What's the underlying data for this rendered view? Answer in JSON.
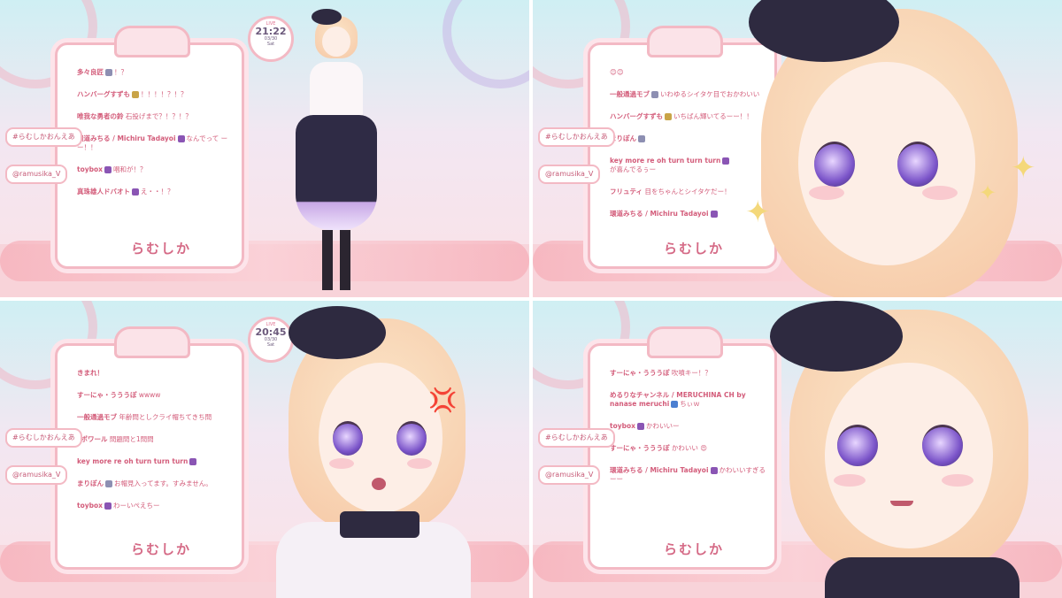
{
  "panels": [
    {
      "chat_tag": "#らむしかおんえあ",
      "handle_tag": "@ramusika_V",
      "logo": "らむしか",
      "clock": {
        "live": "LIVE",
        "time": "21:22",
        "date": "03/30",
        "day": "Sat"
      },
      "messages": [
        {
          "name": "多々良匠",
          "text": "！？"
        },
        {
          "name": "ハンバーグすずも",
          "text": "！！！！？！？"
        },
        {
          "name": "唯我な勇者の鈴",
          "text": "石投げまで？！？！？"
        },
        {
          "name": "環道みちる / Michiru Tadayoi",
          "text": "なんでって ーー！！"
        },
        {
          "name": "toybox",
          "text": "唱和が！？"
        },
        {
          "name": "真珠雄人ドバオト",
          "text": "え・・！？"
        }
      ]
    },
    {
      "chat_tag": "#らむしかおんえあ",
      "handle_tag": "@ramusika_V",
      "logo": "らむしか",
      "messages": [
        {
          "name": "",
          "text": "😊😊"
        },
        {
          "name": "一般通過モブ",
          "text": "いわゆるシイタケ目でおかわいい"
        },
        {
          "name": "ハンバーグすずも",
          "text": "いちばん輝いてるーー！！"
        },
        {
          "name": "まりぽん",
          "text": ""
        },
        {
          "name": "key more re oh turn turn turn",
          "text": "が喜んでるぅー"
        },
        {
          "name": "フリュティ",
          "text": "目をちゃんとシイタケだー！"
        },
        {
          "name": "環道みちる / Michiru Tadayoi",
          "text": ""
        }
      ]
    },
    {
      "chat_tag": "#らむしかおんえあ",
      "handle_tag": "@ramusika_V",
      "logo": "らむしか",
      "clock": {
        "live": "LIVE",
        "time": "20:45",
        "date": "03/30",
        "day": "Sat"
      },
      "messages": [
        {
          "name": "きまれ！",
          "text": ""
        },
        {
          "name": "すーにゃ・うううぽ",
          "text": "wwww"
        },
        {
          "name": "一般通過モブ",
          "text": "年齢問としクライ帽ちてきち問"
        },
        {
          "name": "sポワール",
          "text": "問題問と1問問"
        },
        {
          "name": "key more re oh turn turn turn",
          "text": ""
        },
        {
          "name": "まりぽん",
          "text": "お帽見入ってます。すみません。"
        },
        {
          "name": "toybox",
          "text": "わーいぺえちー"
        }
      ]
    },
    {
      "chat_tag": "#らむしかおんえあ",
      "handle_tag": "@ramusika_V",
      "logo": "らむしか",
      "messages": [
        {
          "name": "すーにゃ・うううぽ",
          "text": "吹噴キー！？"
        },
        {
          "name": "めるりなチャンネル / MERUCHINA CH by nanase meruchi",
          "text": "ちぃｗ"
        },
        {
          "name": "toybox",
          "text": "かわいいー"
        },
        {
          "name": "すーにゃ・うううぽ",
          "text": "かわいい 😍"
        },
        {
          "name": "環道みちる / Michiru Tadayoi",
          "text": "かわいいすぎる ーー"
        }
      ]
    }
  ]
}
